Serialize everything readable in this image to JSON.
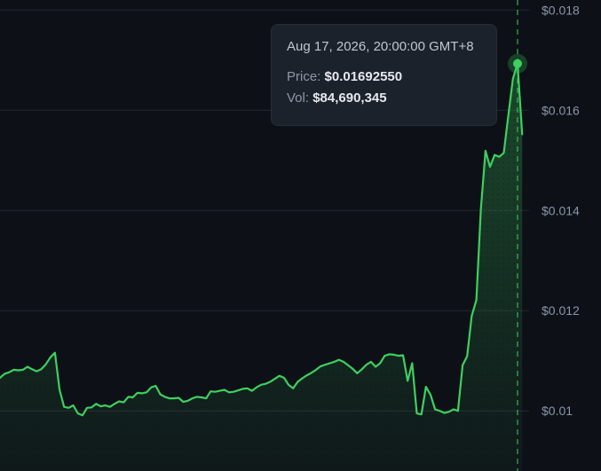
{
  "colors": {
    "background": "#0d1117",
    "line": "#3ecf5f",
    "grid": "#222831",
    "axis_text": "#8b95a7",
    "tooltip_bg": "#1c222c"
  },
  "tooltip": {
    "date": "Aug 17, 2026, 20:00:00 GMT+8",
    "price_label": "Price:",
    "price_value": "$0.01692550",
    "vol_label": "Vol:",
    "vol_value": "$84,690,345"
  },
  "chart_data": {
    "type": "area",
    "title": "",
    "xlabel": "",
    "ylabel": "",
    "y_axis_position": "right",
    "y_ticks": [
      0.01,
      0.012,
      0.014,
      0.016,
      0.018
    ],
    "y_tick_labels": [
      "$0.01",
      "$0.012",
      "$0.014",
      "$0.016",
      "$0.018"
    ],
    "ylim": [
      0.0088,
      0.0182
    ],
    "grid": true,
    "highlight_index": 113,
    "series": [
      {
        "values": [
          0.01066,
          0.01074,
          0.01077,
          0.01082,
          0.01081,
          0.01082,
          0.01088,
          0.01083,
          0.01079,
          0.01083,
          0.01093,
          0.01107,
          0.01116,
          0.01042,
          0.01008,
          0.01006,
          0.01011,
          0.00995,
          0.00991,
          0.01006,
          0.01007,
          0.01014,
          0.01009,
          0.01011,
          0.01008,
          0.01014,
          0.01019,
          0.01017,
          0.01028,
          0.01027,
          0.01036,
          0.01035,
          0.01037,
          0.01047,
          0.0105,
          0.01033,
          0.01028,
          0.01025,
          0.01025,
          0.01026,
          0.01018,
          0.0102,
          0.01025,
          0.01028,
          0.01027,
          0.01025,
          0.01039,
          0.01038,
          0.0104,
          0.01042,
          0.01037,
          0.01038,
          0.01041,
          0.01044,
          0.01045,
          0.0104,
          0.01047,
          0.01052,
          0.01054,
          0.01058,
          0.01064,
          0.0107,
          0.01066,
          0.01052,
          0.01045,
          0.01058,
          0.01065,
          0.01071,
          0.01076,
          0.01082,
          0.01089,
          0.01092,
          0.01095,
          0.01098,
          0.01102,
          0.01098,
          0.01091,
          0.01084,
          0.01075,
          0.01083,
          0.01092,
          0.01098,
          0.01088,
          0.01095,
          0.0111,
          0.01113,
          0.01112,
          0.0111,
          0.01111,
          0.0106,
          0.01095,
          0.00995,
          0.00993,
          0.01048,
          0.01032,
          0.01003,
          0.01,
          0.00996,
          0.00998,
          0.01003,
          0.01,
          0.01091,
          0.01109,
          0.0119,
          0.01221,
          0.01403,
          0.01519,
          0.01487,
          0.01511,
          0.01507,
          0.01515,
          0.01591,
          0.01663,
          0.01693,
          0.01552
        ]
      }
    ]
  }
}
